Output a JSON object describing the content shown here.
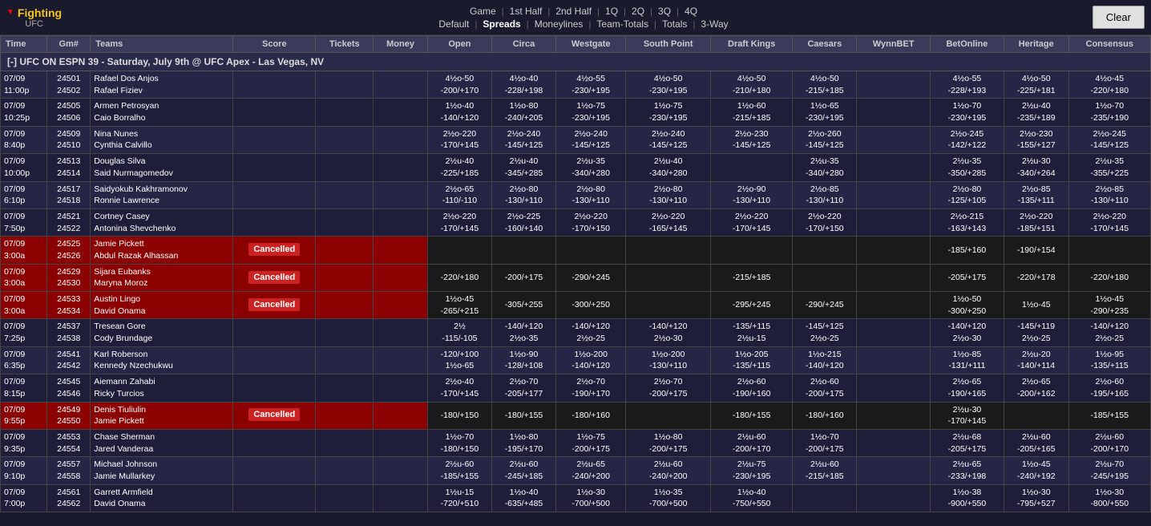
{
  "nav": {
    "sport": "Fighting",
    "sport_sub": "UFC",
    "triangle": "▼",
    "top_links": [
      {
        "label": "Game",
        "url": "#"
      },
      {
        "label": "1st Half",
        "url": "#"
      },
      {
        "label": "2nd Half",
        "url": "#"
      },
      {
        "label": "1Q",
        "url": "#"
      },
      {
        "label": "2Q",
        "url": "#"
      },
      {
        "label": "3Q",
        "url": "#"
      },
      {
        "label": "4Q",
        "url": "#"
      }
    ],
    "bottom_links": [
      {
        "label": "Default",
        "url": "#"
      },
      {
        "label": "Spreads",
        "url": "#",
        "active": true
      },
      {
        "label": "Moneylines",
        "url": "#"
      },
      {
        "label": "Team-Totals",
        "url": "#"
      },
      {
        "label": "Totals",
        "url": "#"
      },
      {
        "label": "3-Way",
        "url": "#"
      }
    ],
    "clear_label": "Clear"
  },
  "columns": {
    "time": "Time",
    "gm": "Gm#",
    "teams": "Teams",
    "score": "Score",
    "tickets": "Tickets",
    "money": "Money",
    "open": "Open",
    "circa": "Circa",
    "westgate": "Westgate",
    "south_point": "South Point",
    "draft_kings": "Draft Kings",
    "caesars": "Caesars",
    "wynnbet": "WynnBET",
    "betonline": "BetOnline",
    "heritage": "Heritage",
    "consensus": "Consensus"
  },
  "event": {
    "label": "[-]  UFC ON ESPN 39 - Saturday, July 9th @ UFC Apex - Las Vegas, NV"
  },
  "rows": [
    {
      "time": "07/09\n11:00p",
      "gm1": "24501",
      "gm2": "24502",
      "team1": "Rafael Dos Anjos",
      "team2": "Rafael Fiziev",
      "score": "",
      "tickets": "",
      "money": "",
      "open": "4½o-50\n-200/+170",
      "circa": "4½o-40\n-228/+198",
      "westgate": "4½o-55\n-230/+195",
      "south_point": "4½o-50\n-230/+195",
      "draft_kings": "4½o-50\n-210/+180",
      "caesars": "4½o-50\n-215/+185",
      "wynnbet": "",
      "betonline": "4½o-55\n-228/+193",
      "heritage": "4½o-50\n-225/+181",
      "consensus": "4½o-45\n-220/+180",
      "cancelled": false
    },
    {
      "time": "07/09\n10:25p",
      "gm1": "24505",
      "gm2": "24506",
      "team1": "Armen Petrosyan",
      "team2": "Caio Borralho",
      "score": "",
      "tickets": "",
      "money": "",
      "open": "1½o-40\n-140/+120",
      "circa": "1½o-80\n-240/+205",
      "westgate": "1½o-75\n-230/+195",
      "south_point": "1½o-75\n-230/+195",
      "draft_kings": "1½o-60\n-215/+185",
      "caesars": "1½o-65\n-230/+195",
      "wynnbet": "",
      "betonline": "1½o-70\n-230/+195",
      "heritage": "2½u-40\n-235/+189",
      "consensus": "1½o-70\n-235/+190",
      "cancelled": false
    },
    {
      "time": "07/09\n8:40p",
      "gm1": "24509",
      "gm2": "24510",
      "team1": "Nina Nunes",
      "team2": "Cynthia Calvillo",
      "score": "",
      "tickets": "",
      "money": "",
      "open": "2½o-220\n-170/+145",
      "circa": "2½o-240\n-145/+125",
      "westgate": "2½o-240\n-145/+125",
      "south_point": "2½o-240\n-145/+125",
      "draft_kings": "2½o-230\n-145/+125",
      "caesars": "2½o-260\n-145/+125",
      "wynnbet": "",
      "betonline": "2½o-245\n-142/+122",
      "heritage": "2½o-230\n-155/+127",
      "consensus": "2½o-245\n-145/+125",
      "cancelled": false
    },
    {
      "time": "07/09\n10:00p",
      "gm1": "24513",
      "gm2": "24514",
      "team1": "Douglas Silva",
      "team2": "Said Nurmagomedov",
      "score": "",
      "tickets": "",
      "money": "",
      "open": "2½u-40\n-225/+185",
      "circa": "2½u-40\n-345/+285",
      "westgate": "2½u-35\n-340/+280",
      "south_point": "2½u-40\n-340/+280",
      "draft_kings": "",
      "caesars": "2½u-35\n-340/+280",
      "wynnbet": "",
      "betonline": "2½u-35\n-350/+285",
      "heritage": "2½u-30\n-340/+264",
      "consensus": "2½u-35\n-355/+225",
      "cancelled": false
    },
    {
      "time": "07/09\n6:10p",
      "gm1": "24517",
      "gm2": "24518",
      "team1": "Saidyokub Kakhramonov",
      "team2": "Ronnie Lawrence",
      "score": "",
      "tickets": "",
      "money": "",
      "open": "2½o-65\n-110/-110",
      "circa": "2½o-80\n-130/+110",
      "westgate": "2½o-80\n-130/+110",
      "south_point": "2½o-80\n-130/+110",
      "draft_kings": "2½o-90\n-130/+110",
      "caesars": "2½o-85\n-130/+110",
      "wynnbet": "",
      "betonline": "2½o-80\n-125/+105",
      "heritage": "2½o-85\n-135/+111",
      "consensus": "2½o-85\n-130/+110",
      "cancelled": false
    },
    {
      "time": "07/09\n7:50p",
      "gm1": "24521",
      "gm2": "24522",
      "team1": "Cortney Casey",
      "team2": "Antonina Shevchenko",
      "score": "",
      "tickets": "",
      "money": "",
      "open": "2½o-220\n-170/+145",
      "circa": "2½o-225\n-160/+140",
      "westgate": "2½o-220\n-170/+150",
      "south_point": "2½o-220\n-165/+145",
      "draft_kings": "2½o-220\n-170/+145",
      "caesars": "2½o-220\n-170/+150",
      "wynnbet": "",
      "betonline": "2½o-215\n-163/+143",
      "heritage": "2½o-220\n-185/+151",
      "consensus": "2½o-220\n-170/+145",
      "cancelled": false
    },
    {
      "time": "07/09\n3:00a",
      "gm1": "24525",
      "gm2": "24526",
      "team1": "Jamie Pickett",
      "team2": "Abdul Razak Alhassan",
      "score": "Cancelled",
      "tickets": "",
      "money": "",
      "open": "",
      "circa": "",
      "westgate": "",
      "south_point": "",
      "draft_kings": "",
      "caesars": "",
      "wynnbet": "",
      "betonline": "-185/+160",
      "heritage": "-190/+154",
      "consensus": "",
      "cancelled": true
    },
    {
      "time": "07/09\n3:00a",
      "gm1": "24529",
      "gm2": "24530",
      "team1": "Sijara Eubanks",
      "team2": "Maryna Moroz",
      "score": "Cancelled",
      "tickets": "",
      "money": "",
      "open": "-220/+180",
      "circa": "-200/+175",
      "westgate": "-290/+245",
      "south_point": "",
      "draft_kings": "-215/+185",
      "caesars": "",
      "wynnbet": "",
      "betonline": "-205/+175",
      "heritage": "-220/+178",
      "consensus": "-220/+180",
      "cancelled": true
    },
    {
      "time": "07/09\n3:00a",
      "gm1": "24533",
      "gm2": "24534",
      "team1": "Austin Lingo",
      "team2": "David Onama",
      "score": "Cancelled",
      "tickets": "",
      "money": "",
      "open": "1½o-45\n-265/+215",
      "circa": "-305/+255",
      "westgate": "-300/+250",
      "south_point": "",
      "draft_kings": "-295/+245",
      "caesars": "-290/+245",
      "wynnbet": "",
      "betonline": "1½o-50\n-300/+250",
      "heritage": "1½o-45\n",
      "consensus": "1½o-45\n-290/+235",
      "cancelled": true
    },
    {
      "time": "07/09\n7:25p",
      "gm1": "24537",
      "gm2": "24538",
      "team1": "Tresean Gore",
      "team2": "Cody Brundage",
      "score": "",
      "tickets": "",
      "money": "",
      "open": "2½\n-115/-105",
      "circa": "-140/+120\n2½o-35",
      "westgate": "-140/+120\n2½o-25",
      "south_point": "-140/+120\n2½o-30",
      "draft_kings": "-135/+115\n2½u-15",
      "caesars": "-145/+125\n2½o-25",
      "wynnbet": "",
      "betonline": "-140/+120\n2½o-30",
      "heritage": "-145/+119\n2½o-25",
      "consensus": "-140/+120\n2½o-25",
      "cancelled": false
    },
    {
      "time": "07/09\n6:35p",
      "gm1": "24541",
      "gm2": "24542",
      "team1": "Karl Roberson",
      "team2": "Kennedy Nzechukwu",
      "score": "",
      "tickets": "",
      "money": "",
      "open": "-120/+100\n1½o-65",
      "circa": "1½o-90\n-128/+108",
      "westgate": "1½o-200\n-140/+120",
      "south_point": "1½o-200\n-130/+110",
      "draft_kings": "1½o-205\n-135/+115",
      "caesars": "1½o-215\n-140/+120",
      "wynnbet": "",
      "betonline": "1½o-85\n-131/+111",
      "heritage": "2½u-20\n-140/+114",
      "consensus": "1½o-95\n-135/+115",
      "cancelled": false
    },
    {
      "time": "07/09\n8:15p",
      "gm1": "24545",
      "gm2": "24546",
      "team1": "Aiemann Zahabi",
      "team2": "Ricky Turcios",
      "score": "",
      "tickets": "",
      "money": "",
      "open": "2½o-40\n-170/+145",
      "circa": "2½o-70\n-205/+177",
      "westgate": "2½o-70\n-190/+170",
      "south_point": "2½o-70\n-200/+175",
      "draft_kings": "2½o-60\n-190/+160",
      "caesars": "2½o-60\n-200/+175",
      "wynnbet": "",
      "betonline": "2½o-65\n-190/+165",
      "heritage": "2½o-65\n-200/+162",
      "consensus": "2½o-60\n-195/+165",
      "cancelled": false
    },
    {
      "time": "07/09\n9:55p",
      "gm1": "24549",
      "gm2": "24550",
      "team1": "Denis Tiuliulin",
      "team2": "Jamie Pickett",
      "score": "Cancelled",
      "tickets": "",
      "money": "",
      "open": "-180/+150",
      "circa": "-180/+155",
      "westgate": "-180/+160",
      "south_point": "",
      "draft_kings": "-180/+155",
      "caesars": "-180/+160",
      "wynnbet": "",
      "betonline": "2½u-30\n-170/+145",
      "heritage": "",
      "consensus": "-185/+155",
      "cancelled": true
    },
    {
      "time": "07/09\n9:35p",
      "gm1": "24553",
      "gm2": "24554",
      "team1": "Chase Sherman",
      "team2": "Jared Vanderaa",
      "score": "",
      "tickets": "",
      "money": "",
      "open": "1½o-70\n-180/+150",
      "circa": "1½o-80\n-195/+170",
      "westgate": "1½o-75\n-200/+175",
      "south_point": "1½o-80\n-200/+175",
      "draft_kings": "2½u-60\n-200/+170",
      "caesars": "1½o-70\n-200/+175",
      "wynnbet": "",
      "betonline": "2½u-68\n-205/+175",
      "heritage": "2½u-60\n-205/+165",
      "consensus": "2½u-60\n-200/+170",
      "cancelled": false
    },
    {
      "time": "07/09\n9:10p",
      "gm1": "24557",
      "gm2": "24558",
      "team1": "Michael Johnson",
      "team2": "Jamie Mullarkey",
      "score": "",
      "tickets": "",
      "money": "",
      "open": "2½u-60\n-185/+155",
      "circa": "2½u-60\n-245/+185",
      "westgate": "2½u-65\n-240/+200",
      "south_point": "2½u-60\n-240/+200",
      "draft_kings": "2½u-75\n-230/+195",
      "caesars": "2½u-60\n-215/+185",
      "wynnbet": "",
      "betonline": "2½u-65\n-233/+198",
      "heritage": "1½o-45\n-240/+192",
      "consensus": "2½u-70\n-245/+195",
      "cancelled": false
    },
    {
      "time": "07/09\n7:00p",
      "gm1": "24561",
      "gm2": "24562",
      "team1": "Garrett Armfield",
      "team2": "David Onama",
      "score": "",
      "tickets": "",
      "money": "",
      "open": "1½u-15\n-720/+510",
      "circa": "1½o-40\n-635/+485",
      "westgate": "1½o-30\n-700/+500",
      "south_point": "1½o-35\n-700/+500",
      "draft_kings": "1½o-40\n-750/+550",
      "caesars": "",
      "wynnbet": "",
      "betonline": "1½o-38\n-900/+550",
      "heritage": "1½o-30\n-795/+527",
      "consensus": "1½o-30\n-800/+550",
      "cancelled": false
    }
  ]
}
